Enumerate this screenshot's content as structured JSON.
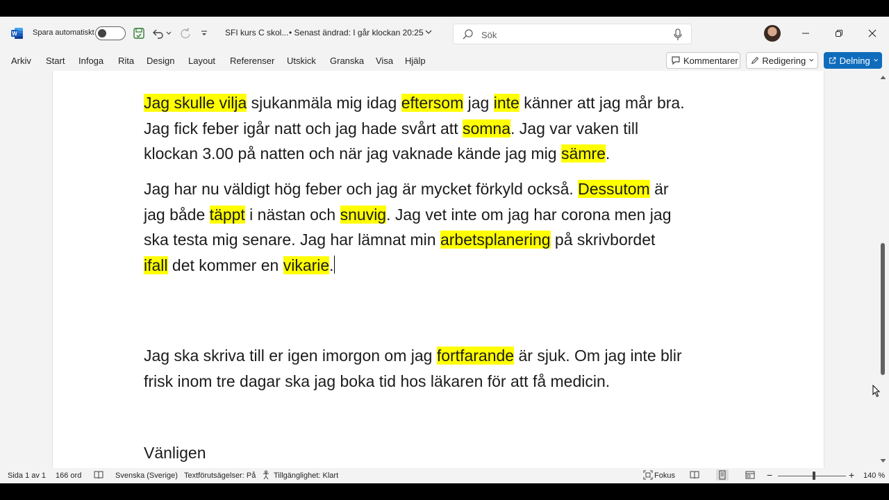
{
  "titlebar": {
    "autosave_label": "Spara automatiskt",
    "doc_title": "SFI kurs C skol...",
    "doc_status": "• Senast ändrad: I går klockan 20:25",
    "search_placeholder": "Sök"
  },
  "ribbon": {
    "tabs": [
      "Arkiv",
      "Start",
      "Infoga",
      "Rita",
      "Design",
      "Layout",
      "Referenser",
      "Utskick",
      "Granska",
      "Visa",
      "Hjälp"
    ],
    "comments_label": "Kommentarer",
    "editing_label": "Redigering",
    "share_label": "Delning"
  },
  "document": {
    "p1": {
      "l1": [
        "Jag skulle vilja",
        " sjukanmäla mig idag ",
        "eftersom",
        " jag ",
        "inte",
        " känner att jag mår bra."
      ],
      "l2": [
        "Jag fick feber igår natt och jag hade svårt att ",
        "somna",
        ". Jag var vaken till"
      ],
      "l3": [
        "klockan 3.00 på natten och när jag vaknade kände jag mig ",
        "sämre",
        "."
      ]
    },
    "p2": {
      "l1": [
        "Jag har nu väldigt hög feber och jag är mycket förkyld också. ",
        "Dessutom",
        " är"
      ],
      "l2": [
        "jag både ",
        "täppt",
        " i nästan och ",
        "snuvig",
        ". Jag vet inte om jag har corona men jag"
      ],
      "l3": [
        "ska testa mig senare. Jag har lämnat min ",
        "arbetsplanering",
        " på skrivbordet"
      ],
      "l4": [
        "ifall",
        " det kommer en ",
        "vikarie",
        "."
      ]
    },
    "p3": {
      "l1": [
        "Jag ska skriva till er igen imorgon om jag ",
        "fortfarande",
        " är sjuk. Om jag inte blir"
      ],
      "l2": "frisk inom tre dagar ska jag boka tid hos läkaren för att få medicin."
    },
    "closing": "Vänligen",
    "highlight_color": "#ffff00"
  },
  "statusbar": {
    "page": "Sida 1 av 1",
    "words": "166 ord",
    "language": "Svenska (Sverige)",
    "predictions": "Textförutsägelser: På",
    "accessibility": "Tillgänglighet: Klart",
    "focus": "Fokus",
    "zoom": "140 %"
  },
  "colors": {
    "accent": "#0f6cbd",
    "background": "#f3f3f3"
  }
}
